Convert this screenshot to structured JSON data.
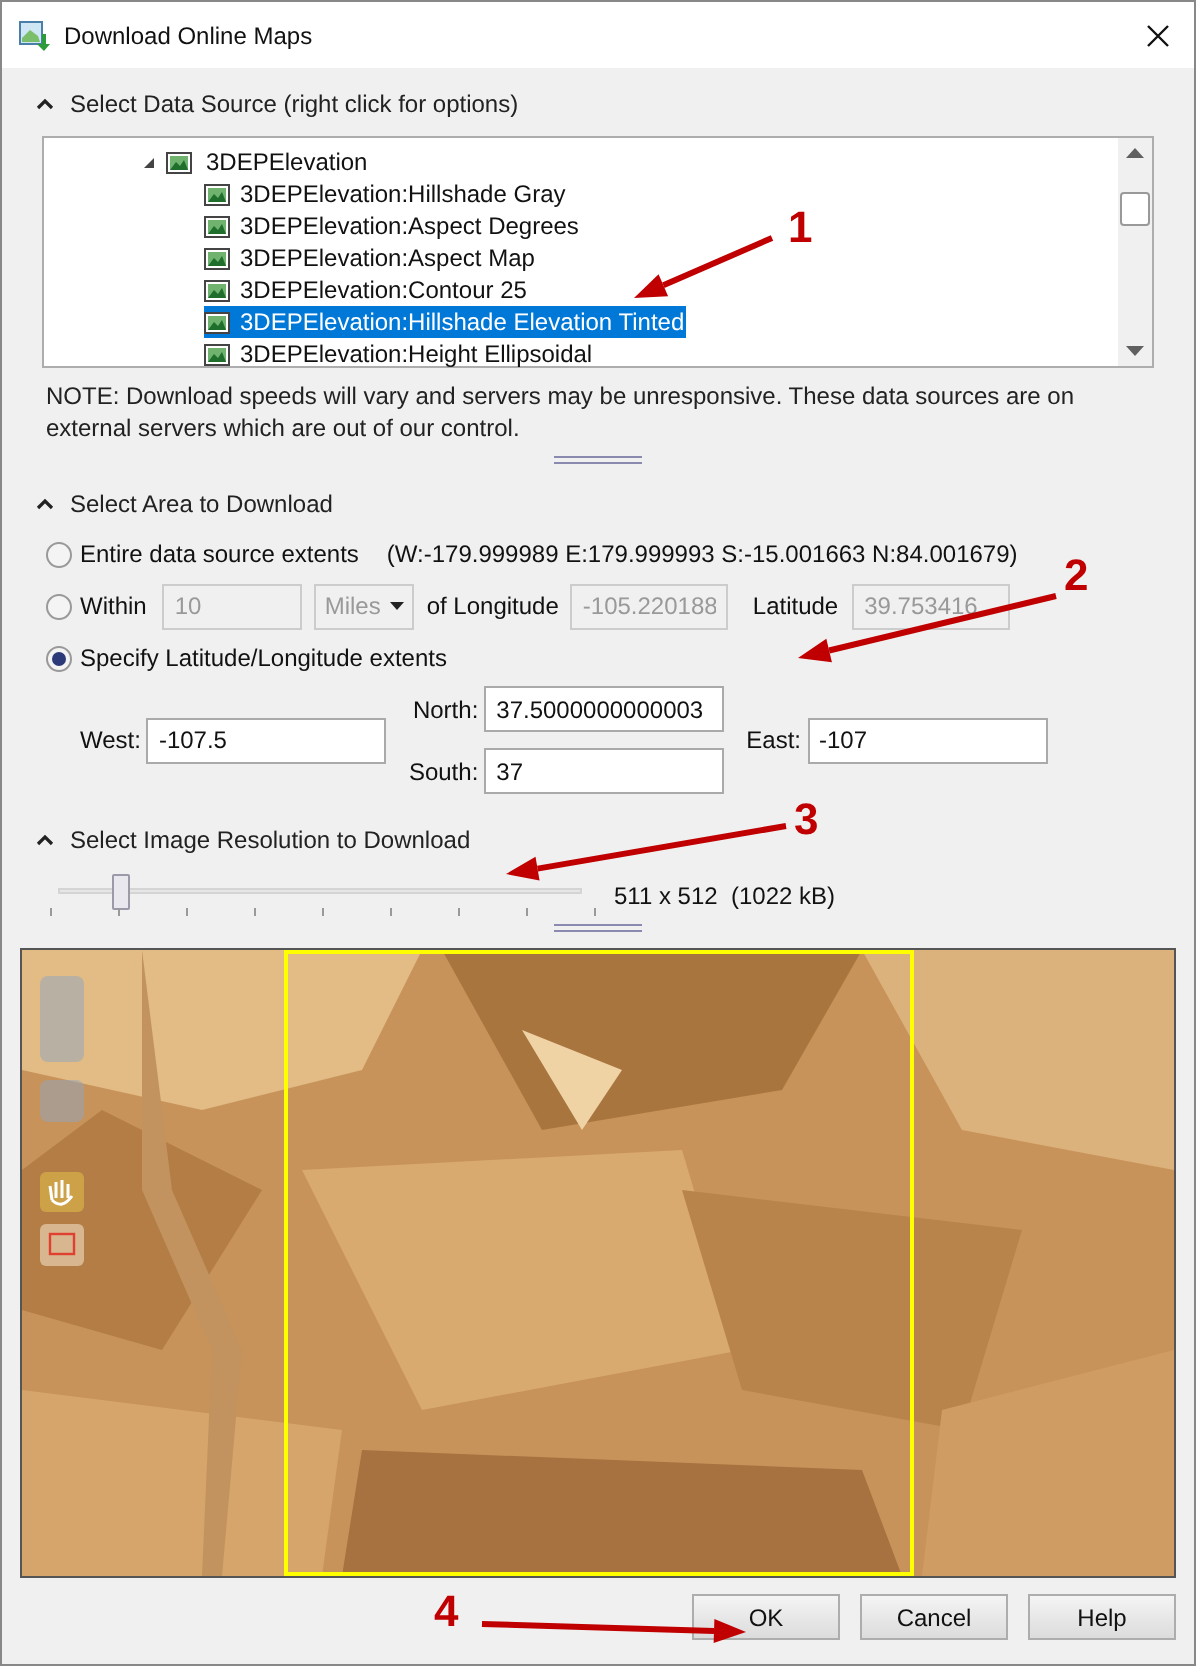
{
  "window": {
    "title": "Download Online Maps"
  },
  "data_source": {
    "heading": "Select Data Source (right click for options)",
    "expanded": true,
    "tree": [
      {
        "label": "3DEPElevation",
        "expanded": true,
        "children": [
          {
            "label": "3DEPElevation:Hillshade Gray",
            "selected": false
          },
          {
            "label": "3DEPElevation:Aspect Degrees",
            "selected": false
          },
          {
            "label": "3DEPElevation:Aspect Map",
            "selected": false
          },
          {
            "label": "3DEPElevation:Contour 25",
            "selected": false
          },
          {
            "label": "3DEPElevation:Hillshade Elevation Tinted",
            "selected": true
          },
          {
            "label": "3DEPElevation:Height Ellipsoidal",
            "selected": false
          }
        ]
      }
    ],
    "note": "NOTE: Download speeds will vary and servers may be unresponsive.  These data sources are on external servers which are out of our control."
  },
  "area": {
    "heading": "Select Area to Download",
    "expanded": true,
    "options": [
      {
        "kind": "entire",
        "label": "Entire data source extents",
        "selected": false,
        "extents": "(W:-179.999989 E:179.999993 S:-15.001663 N:84.001679)"
      },
      {
        "kind": "within",
        "label": "Within",
        "selected": false,
        "distance": "10",
        "unit": "Miles",
        "longitude_label": "of Longitude",
        "longitude": "-105.220188",
        "latitude_label": "Latitude",
        "latitude": "39.753416"
      },
      {
        "kind": "extents",
        "label": "Specify Latitude/Longitude extents",
        "selected": true
      }
    ],
    "west": {
      "label": "West:",
      "value": "-107.5"
    },
    "north": {
      "label": "North:",
      "value": "37.5000000000003"
    },
    "south": {
      "label": "South:",
      "value": "37"
    },
    "east": {
      "label": "East:",
      "value": "-107"
    }
  },
  "resolution": {
    "heading": "Select Image Resolution to Download",
    "expanded": true,
    "level": 0.12,
    "reading": "511 x 512  (1022 kB)"
  },
  "callouts": [
    "1",
    "2",
    "3",
    "4"
  ],
  "buttons": [
    {
      "label": "OK"
    },
    {
      "label": "Cancel"
    },
    {
      "label": "Help"
    }
  ]
}
